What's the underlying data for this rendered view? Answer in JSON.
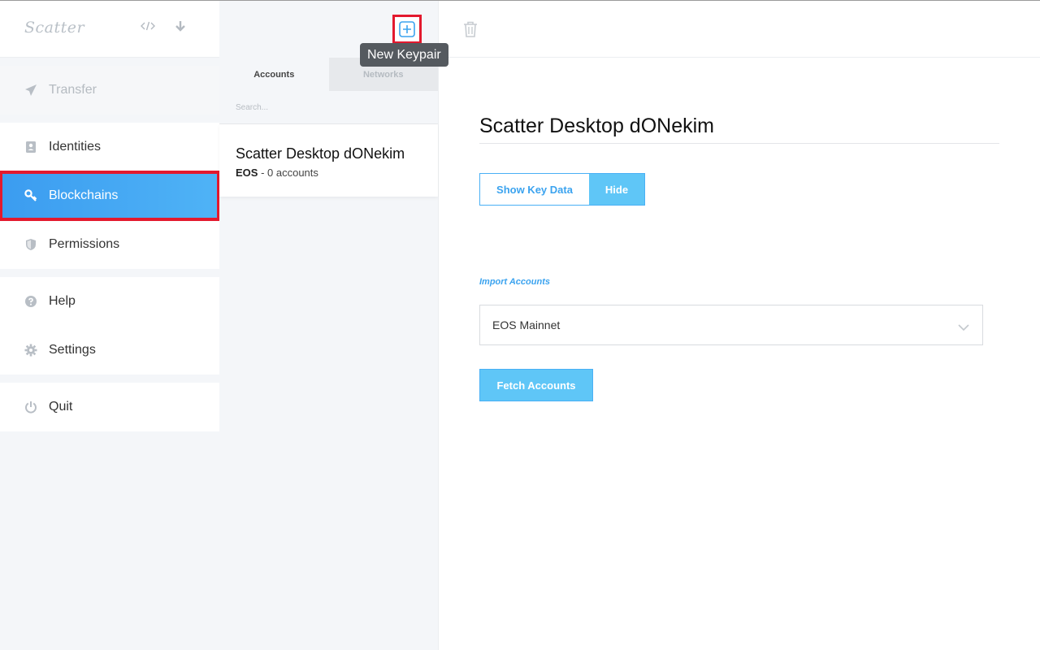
{
  "sidebar": {
    "logo": "Scatter",
    "groups": [
      [
        {
          "label": "Transfer",
          "icon": "paper-plane-icon",
          "state": "disabled"
        }
      ],
      [
        {
          "label": "Identities",
          "icon": "id-card-icon",
          "state": "normal"
        },
        {
          "label": "Blockchains",
          "icon": "key-icon",
          "state": "active"
        },
        {
          "label": "Permissions",
          "icon": "shield-icon",
          "state": "normal"
        }
      ],
      [
        {
          "label": "Help",
          "icon": "question-circle-icon",
          "state": "normal"
        },
        {
          "label": "Settings",
          "icon": "gear-icon",
          "state": "normal"
        }
      ],
      [
        {
          "label": "Quit",
          "icon": "power-icon",
          "state": "normal"
        }
      ]
    ]
  },
  "middle": {
    "tabs": [
      {
        "label": "Accounts",
        "active": true
      },
      {
        "label": "Networks",
        "active": false
      }
    ],
    "search_placeholder": "Search...",
    "keypair": {
      "name": "Scatter Desktop dONekim",
      "blockchain": "EOS",
      "accounts_text": " - 0 accounts"
    }
  },
  "tooltip": "New Keypair",
  "main": {
    "title": "Scatter Desktop dONekim",
    "show_key_label": "Show Key Data",
    "hide_label": "Hide",
    "import_label": "Import Accounts",
    "network_select": "EOS Mainnet",
    "fetch_label": "Fetch Accounts"
  },
  "colors": {
    "accent": "#3ba3ef",
    "accent_light": "#5fc6f7",
    "highlight_red": "#e3192e"
  }
}
